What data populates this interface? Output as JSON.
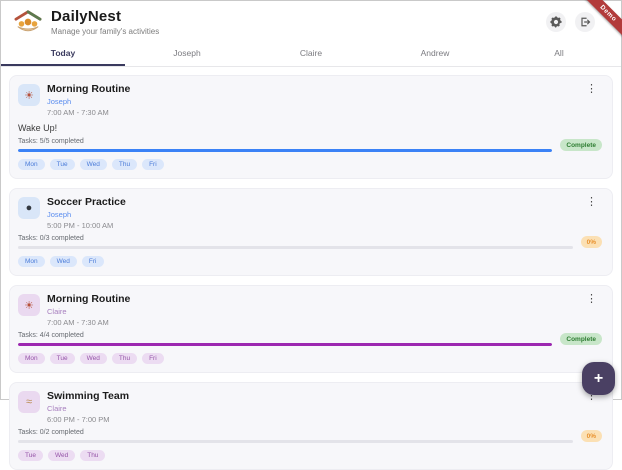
{
  "app": {
    "title": "DailyNest",
    "subtitle": "Manage your family's activities",
    "ribbon": "Demo"
  },
  "icons": {
    "settings": "gear-icon",
    "logout": "logout-icon",
    "more": "⋮"
  },
  "colors": {
    "ribbon": "#b23b3b",
    "tab_active": "#3a3a5e",
    "blue_accent": "#3b82f6",
    "purple_accent": "#9c27b0",
    "member_blue": "#5b8def",
    "member_purple": "#a77fbe",
    "blue_chip_bg": "#dbe7fb",
    "blue_chip_text": "#4a7bd8",
    "purple_chip_bg": "#ecdcf2",
    "purple_chip_text": "#9553a8",
    "complete_bg": "#c8e6c9",
    "complete_text": "#2e7d32",
    "pct_bg": "#fbe0b4",
    "pct_text": "#e8912e",
    "fab": "#4a4063"
  },
  "tabs": [
    {
      "label": "Today",
      "active": true
    },
    {
      "label": "Joseph",
      "active": false
    },
    {
      "label": "Claire",
      "active": false
    },
    {
      "label": "Andrew",
      "active": false
    },
    {
      "label": "All",
      "active": false
    }
  ],
  "cards": [
    {
      "title": "Morning Routine",
      "member": "Joseph",
      "time": "7:00 AM - 7:30 AM",
      "description": "Wake Up!",
      "tasks_label": "Tasks: 5/5 completed",
      "progress_pct": 100,
      "badge": "Complete",
      "badge_type": "complete",
      "days": [
        "Mon",
        "Tue",
        "Wed",
        "Thu",
        "Fri"
      ],
      "theme": "blue",
      "emoji": "☀",
      "kind": "morning"
    },
    {
      "title": "Soccer Practice",
      "member": "Joseph",
      "time": "5:00 PM - 10:00 AM",
      "description": "",
      "tasks_label": "Tasks: 0/3 completed",
      "progress_pct": 0,
      "badge": "0%",
      "badge_type": "pct",
      "days": [
        "Mon",
        "Wed",
        "Fri"
      ],
      "theme": "blue",
      "emoji": "●",
      "kind": "soccer"
    },
    {
      "title": "Morning Routine",
      "member": "Claire",
      "time": "7:00 AM - 7:30 AM",
      "description": "",
      "tasks_label": "Tasks: 4/4 completed",
      "progress_pct": 100,
      "badge": "Complete",
      "badge_type": "complete",
      "days": [
        "Mon",
        "Tue",
        "Wed",
        "Thu",
        "Fri"
      ],
      "theme": "purple",
      "emoji": "☀",
      "kind": "morning"
    },
    {
      "title": "Swimming Team",
      "member": "Claire",
      "time": "6:00 PM - 7:00 PM",
      "description": "",
      "tasks_label": "Tasks: 0/2 completed",
      "progress_pct": 0,
      "badge": "0%",
      "badge_type": "pct",
      "days": [
        "Tue",
        "Wed",
        "Thu"
      ],
      "theme": "purple",
      "emoji": "≈",
      "kind": "swim"
    }
  ],
  "fab": {
    "label": "+"
  }
}
